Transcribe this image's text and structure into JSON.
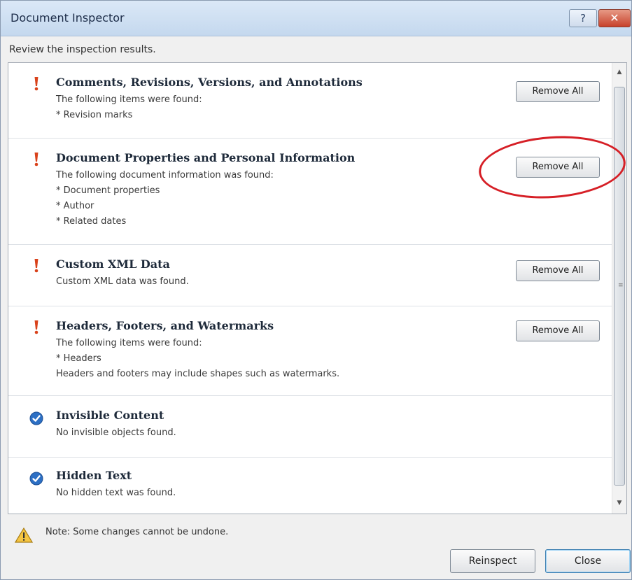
{
  "window": {
    "title": "Document Inspector",
    "help_label": "?",
    "close_label": "✕"
  },
  "subtitle": "Review the inspection results.",
  "items": [
    {
      "status": "warning",
      "title": "Comments, Revisions, Versions, and Annotations",
      "lines": [
        "The following items were found:",
        "* Revision marks"
      ],
      "button": "Remove All"
    },
    {
      "status": "warning",
      "title": "Document Properties and Personal Information",
      "lines": [
        "The following document information was found:",
        "* Document properties",
        "* Author",
        "* Related dates"
      ],
      "button": "Remove All"
    },
    {
      "status": "warning",
      "title": "Custom XML Data",
      "lines": [
        "Custom XML data was found."
      ],
      "button": "Remove All"
    },
    {
      "status": "warning",
      "title": "Headers, Footers, and Watermarks",
      "lines": [
        "The following items were found:",
        "* Headers",
        "Headers and footers may include shapes such as watermarks."
      ],
      "button": "Remove All"
    },
    {
      "status": "ok",
      "title": "Invisible Content",
      "lines": [
        "No invisible objects found."
      ],
      "button": ""
    },
    {
      "status": "ok",
      "title": "Hidden Text",
      "lines": [
        "No hidden text was found."
      ],
      "button": ""
    }
  ],
  "note": "Note: Some changes cannot be undone.",
  "footer": {
    "reinspect_label": "Reinspect",
    "close_label": "Close"
  },
  "colors": {
    "warning": "#d9421b",
    "ok": "#2c6fc4",
    "highlight": "#d61f26"
  }
}
